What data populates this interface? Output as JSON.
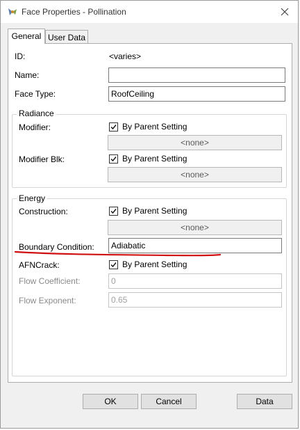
{
  "window": {
    "title": "Face Properties - Pollination",
    "app_icon": "pollination-icon",
    "close_icon": "close-icon"
  },
  "tabs": [
    {
      "label": "General",
      "active": true
    },
    {
      "label": "User Data",
      "active": false
    }
  ],
  "general": {
    "id_label": "ID:",
    "id_value": "<varies>",
    "name_label": "Name:",
    "name_value": "",
    "face_type_label": "Face Type:",
    "face_type_value": "RoofCeiling"
  },
  "radiance": {
    "title": "Radiance",
    "modifier_label": "Modifier:",
    "modifier_check_label": "By Parent Setting",
    "modifier_checked": true,
    "modifier_value": "<none>",
    "modifier_blk_label": "Modifier Blk:",
    "modifier_blk_check_label": "By Parent Setting",
    "modifier_blk_checked": true,
    "modifier_blk_value": "<none>"
  },
  "energy": {
    "title": "Energy",
    "construction_label": "Construction:",
    "construction_check_label": "By Parent Setting",
    "construction_checked": true,
    "construction_value": "<none>",
    "boundary_label": "Boundary Condition:",
    "boundary_value": "Adiabatic",
    "afncrack_label": "AFNCrack:",
    "afncrack_check_label": "By Parent Setting",
    "afncrack_checked": true,
    "flow_coeff_label": "Flow Coefficient:",
    "flow_coeff_value": "0",
    "flow_exp_label": "Flow Exponent:",
    "flow_exp_value": "0.65"
  },
  "buttons": {
    "ok": "OK",
    "cancel": "Cancel",
    "data": "Data"
  },
  "colors": {
    "annotation": "#d01010",
    "checkmark": "#1a1a1a"
  }
}
